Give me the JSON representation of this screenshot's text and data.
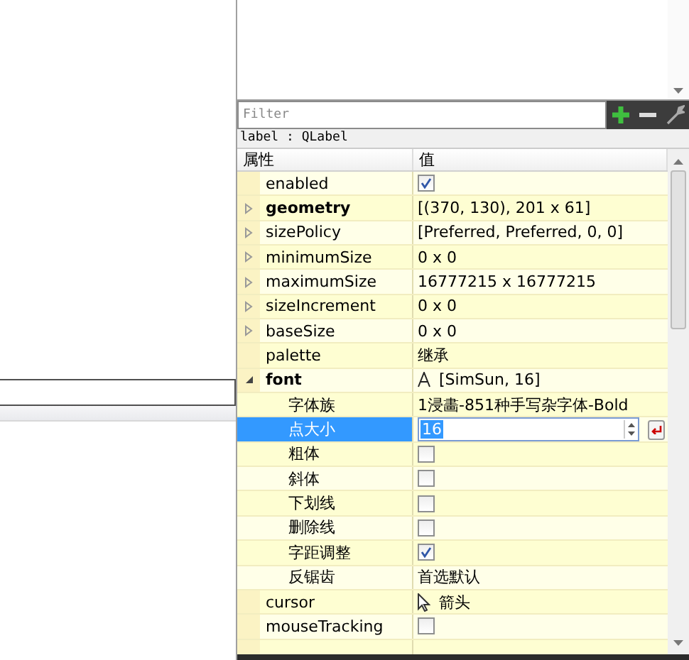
{
  "filter": {
    "placeholder": "Filter"
  },
  "object_label": "label : QLabel",
  "columns": [
    "属性",
    "值"
  ],
  "rows": [
    {
      "name": "enabled",
      "bold": false,
      "expandable": false,
      "kind": "checkbox",
      "checked": true,
      "selected": false
    },
    {
      "name": "geometry",
      "bold": true,
      "expandable": true,
      "expanded": false,
      "kind": "text",
      "value": "[(370, 130), 201 x 61]",
      "selected": false
    },
    {
      "name": "sizePolicy",
      "bold": false,
      "expandable": true,
      "expanded": false,
      "kind": "text",
      "value": "[Preferred, Preferred, 0, 0]",
      "selected": false
    },
    {
      "name": "minimumSize",
      "bold": false,
      "expandable": true,
      "expanded": false,
      "kind": "text",
      "value": "0 x 0",
      "selected": false
    },
    {
      "name": "maximumSize",
      "bold": false,
      "expandable": true,
      "expanded": false,
      "kind": "text",
      "value": "16777215 x 16777215",
      "selected": false
    },
    {
      "name": "sizeIncrement",
      "bold": false,
      "expandable": true,
      "expanded": false,
      "kind": "text",
      "value": "0 x 0",
      "selected": false
    },
    {
      "name": "baseSize",
      "bold": false,
      "expandable": true,
      "expanded": false,
      "kind": "text",
      "value": "0 x 0",
      "selected": false
    },
    {
      "name": "palette",
      "bold": false,
      "expandable": false,
      "kind": "text",
      "value": "继承",
      "selected": false
    },
    {
      "name": "font",
      "bold": true,
      "expandable": true,
      "expanded": true,
      "kind": "font",
      "value": "[SimSun, 16]",
      "selected": false,
      "children": [
        {
          "name": "字体族",
          "kind": "text",
          "value": "1浸畵-851种手写杂字体-Bold",
          "selected": false
        },
        {
          "name": "点大小",
          "kind": "spin",
          "value": "16",
          "selected": true
        },
        {
          "name": "粗体",
          "kind": "checkbox",
          "checked": false,
          "selected": false
        },
        {
          "name": "斜体",
          "kind": "checkbox",
          "checked": false,
          "selected": false
        },
        {
          "name": "下划线",
          "kind": "checkbox",
          "checked": false,
          "selected": false
        },
        {
          "name": "删除线",
          "kind": "checkbox",
          "checked": false,
          "selected": false
        },
        {
          "name": "字距调整",
          "kind": "checkbox",
          "checked": true,
          "selected": false
        },
        {
          "name": "反锯齿",
          "kind": "text",
          "value": "首选默认",
          "selected": false
        }
      ]
    },
    {
      "name": "cursor",
      "bold": false,
      "expandable": false,
      "kind": "cursor",
      "value": "箭头",
      "selected": false
    },
    {
      "name": "mouseTracking",
      "bold": false,
      "expandable": false,
      "kind": "checkbox",
      "checked": false,
      "selected": false
    }
  ]
}
